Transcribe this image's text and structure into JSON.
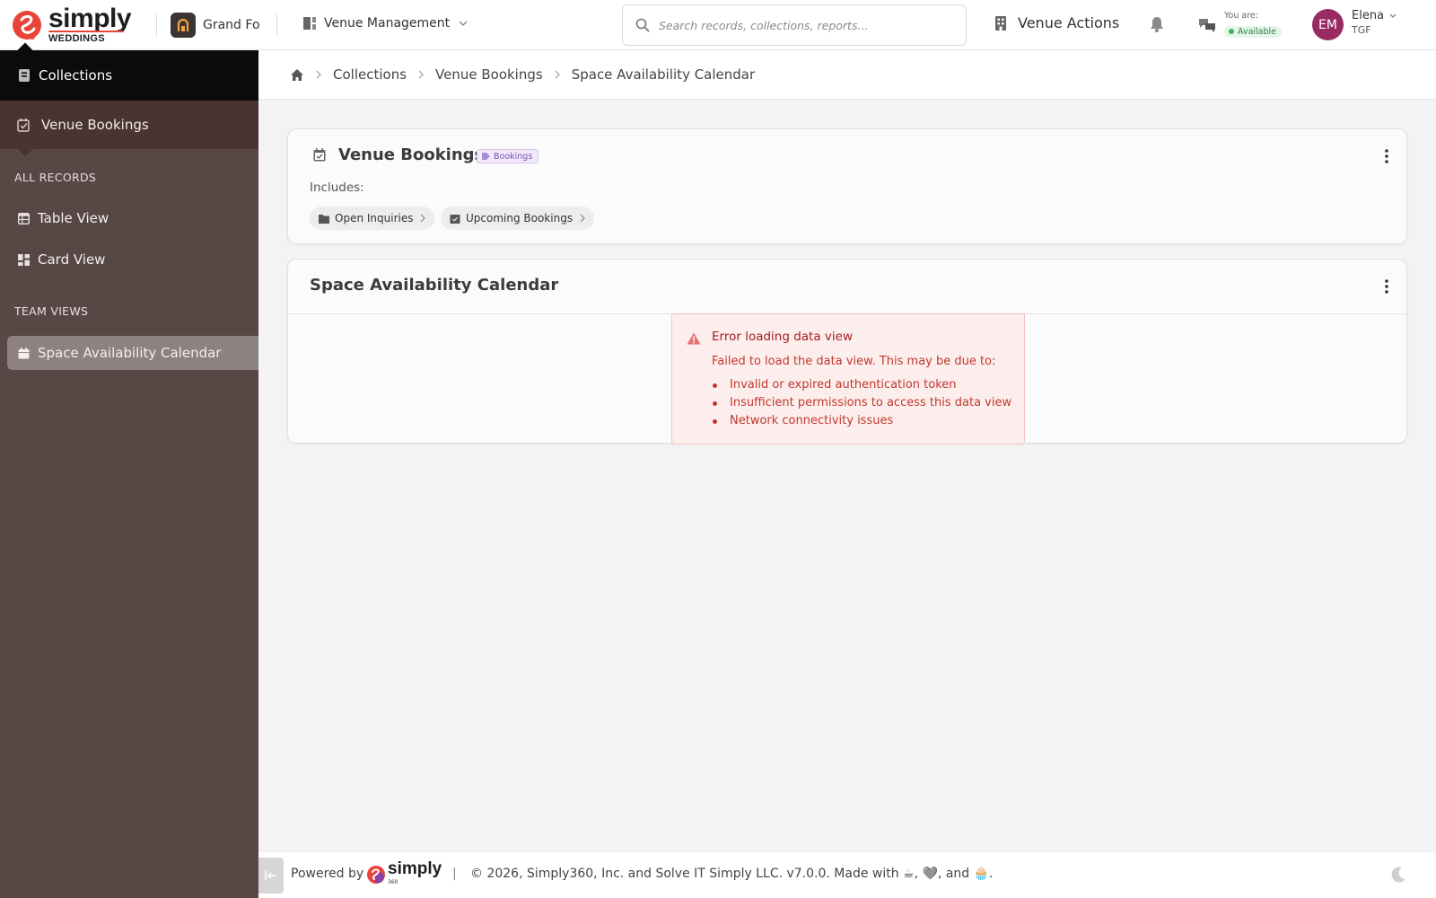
{
  "brand": {
    "name": "simply",
    "subtitle": "WEDDINGS"
  },
  "org": {
    "name": "Grand Fo"
  },
  "module": {
    "label": "Venue Management"
  },
  "search": {
    "placeholder": "Search records, collections, reports..."
  },
  "header": {
    "venue_actions": "Venue Actions",
    "status_label": "You are:",
    "status_value": "Available",
    "avatar_initials": "EM",
    "user_name": "Elena",
    "user_org": "TGF"
  },
  "sidebar": {
    "collections": "Collections",
    "current_collection": "Venue Bookings",
    "section_all": "ALL RECORDS",
    "all_items": [
      "Table View",
      "Card View"
    ],
    "section_team": "TEAM VIEWS",
    "team_items": [
      "Space Availability Calendar"
    ]
  },
  "breadcrumb": [
    "Collections",
    "Venue Bookings",
    "Space Availability Calendar"
  ],
  "collection_card": {
    "title": "Venue Bookings",
    "tag": "Bookings",
    "includes_label": "Includes:",
    "chips": [
      "Open Inquiries",
      "Upcoming Bookings"
    ]
  },
  "view_card": {
    "title": "Space Availability Calendar",
    "error_title": "Error loading data view",
    "error_message": "Failed to load the data view. This may be due to:",
    "error_reasons": [
      "Invalid or expired authentication token",
      "Insufficient permissions to access this data view",
      "Network connectivity issues"
    ]
  },
  "footer": {
    "powered_by": "Powered by",
    "logo_word": "simply",
    "logo_sub": "360",
    "separator": "|",
    "copyright": "© 2026, Simply360, Inc. and Solve IT Simply LLC. v7.0.0. Made with ☕, 🩶, and 🧁."
  },
  "colors": {
    "accent": "#e8443a",
    "sidebar": "#574845",
    "avatar": "#9a2a62",
    "error": "#c0392b"
  }
}
